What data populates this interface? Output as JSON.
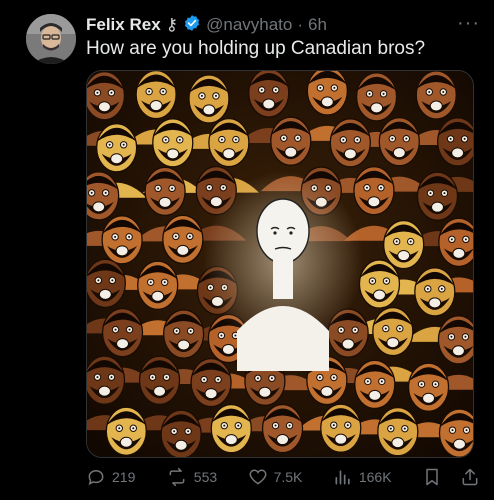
{
  "author": {
    "display_name": "Felix Rex",
    "symbol": "⚷",
    "handle": "@navyhato",
    "separator": "·",
    "time": "6h"
  },
  "tweet": {
    "text": "How are you holding up Canadian bros?"
  },
  "media": {
    "icon": "wojak-crowd-image"
  },
  "actions": {
    "replies": "219",
    "reposts": "553",
    "likes": "7.5K",
    "views": "166K"
  },
  "colors": {
    "background": "#000000",
    "text": "#e7e9ea",
    "muted": "#71767b",
    "verified": "#1d9bf0"
  }
}
